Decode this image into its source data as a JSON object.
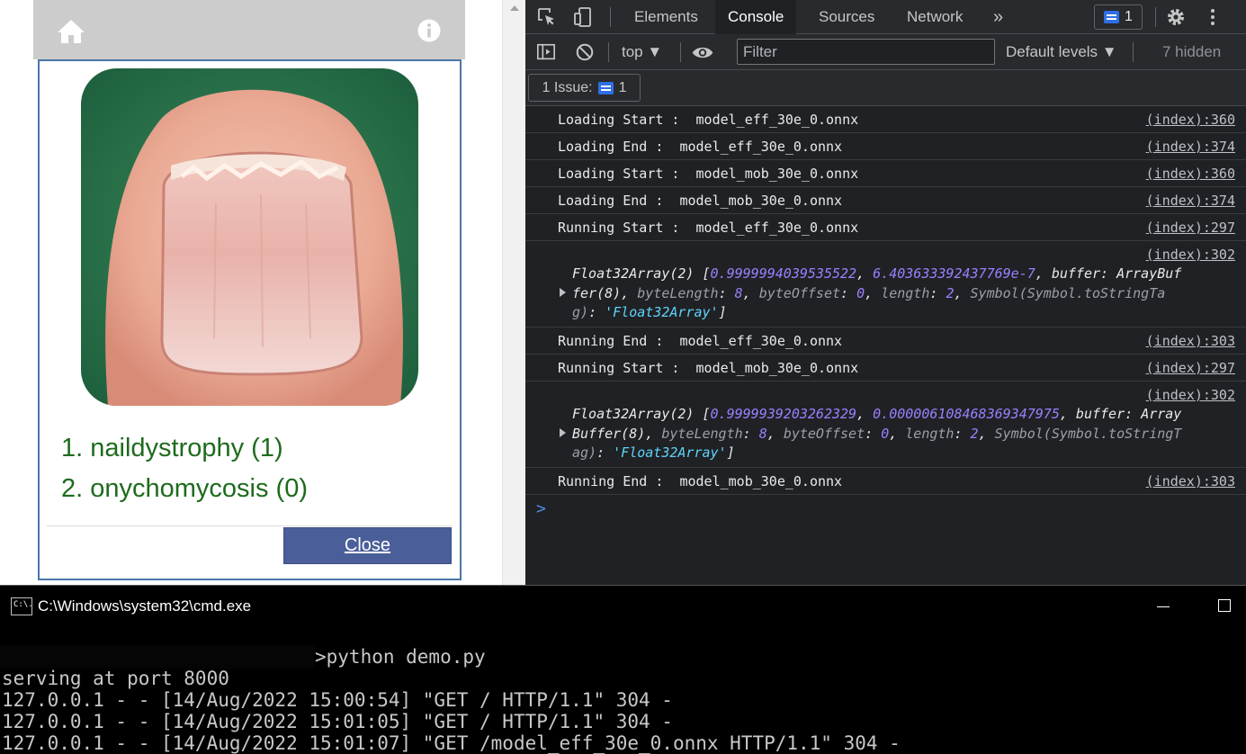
{
  "app": {
    "results": [
      "1. naildystrophy (1)",
      "2. onychomycosis (0)"
    ],
    "close_label": "Close",
    "colors": {
      "header": "#cccccc",
      "modal_border": "#4a76a8",
      "result_text": "#1e6b1e",
      "close_button": "#4a5e99"
    }
  },
  "devtools": {
    "tabs": [
      "Elements",
      "Console",
      "Sources",
      "Network"
    ],
    "more_tabs": "»",
    "issues_count": "1",
    "context": "top ▼",
    "filter_placeholder": "Filter",
    "levels": "Default levels ▼",
    "hidden": "7 hidden",
    "issue_button_label": "1 Issue:",
    "issue_button_count": "1",
    "logs": [
      {
        "type": "single",
        "msg": "Loading Start :  model_eff_30e_0.onnx",
        "src": "(index):360"
      },
      {
        "type": "single",
        "msg": "Loading End :  model_eff_30e_0.onnx",
        "src": "(index):374"
      },
      {
        "type": "single",
        "msg": "Loading Start :  model_mob_30e_0.onnx",
        "src": "(index):360"
      },
      {
        "type": "single",
        "msg": "Loading End :  model_mob_30e_0.onnx",
        "src": "(index):374"
      },
      {
        "type": "single",
        "msg": "Running Start :  model_eff_30e_0.onnx",
        "src": "(index):297"
      },
      {
        "type": "array",
        "src": "(index):302",
        "v0": "0.9999994039535522",
        "v1": "6.403633392437769e-7",
        "buf1": "ArrayBuf",
        "buf2": "fer(8)",
        "tail": "Symbol(Symbol.toStringTa",
        "tail2": "g)",
        "tagval": "'Float32Array'"
      },
      {
        "type": "single",
        "msg": "Running End :  model_eff_30e_0.onnx",
        "src": "(index):303"
      },
      {
        "type": "single",
        "msg": "Running Start :  model_mob_30e_0.onnx",
        "src": "(index):297"
      },
      {
        "type": "array",
        "src": "(index):302",
        "v0": "0.9999939203262329",
        "v1": "0.000006108468369347975",
        "buf1": "Array",
        "buf2": "Buffer(8)",
        "tail": "Symbol(Symbol.toStringT",
        "tail2": "ag)",
        "tagval": "'Float32Array'"
      },
      {
        "type": "single",
        "msg": "Running End :  model_mob_30e_0.onnx",
        "src": "(index):303"
      }
    ],
    "prompt": ">",
    "colors": {
      "background": "#202124",
      "toolbar": "#292a2d",
      "number": "#9980ff",
      "string": "#5cd5fb",
      "accent": "#2e6fe6"
    }
  },
  "cmd": {
    "icon_text": "C:\\.",
    "title": "C:\\Windows\\system32\\cmd.exe",
    "lines": [
      ">python demo.py",
      "serving at port 8000",
      "127.0.0.1 - - [14/Aug/2022 15:00:54] \"GET / HTTP/1.1\" 304 -",
      "127.0.0.1 - - [14/Aug/2022 15:01:05] \"GET / HTTP/1.1\" 304 -",
      "127.0.0.1 - - [14/Aug/2022 15:01:07] \"GET /model_eff_30e_0.onnx HTTP/1.1\" 304 -"
    ]
  }
}
